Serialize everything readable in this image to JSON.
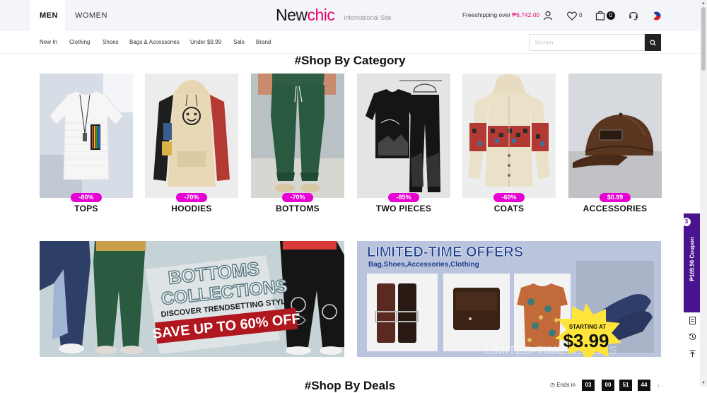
{
  "header": {
    "tabs": [
      {
        "label": "MEN",
        "active": true
      },
      {
        "label": "WOMEN",
        "active": false
      }
    ],
    "logo_main": "New",
    "logo_accent": "chic",
    "logo_sub": "International Site",
    "freeship_label": "Freeshipping over ",
    "freeship_amount": "₱6,742.00",
    "wishlist_count": "0",
    "cart_count": "0"
  },
  "nav": {
    "items": [
      "New In",
      "Clothing",
      "Shoes",
      "Bags & Accessories",
      "Under $9.99",
      "Sale",
      "Brand"
    ],
    "search_placeholder": "kitchen"
  },
  "categories_section": {
    "title": "#Shop By Category",
    "items": [
      {
        "name": "TOPS",
        "badge": "-80%"
      },
      {
        "name": "HOODIES",
        "badge": "-70%"
      },
      {
        "name": "BOTTOMS",
        "badge": "-70%"
      },
      {
        "name": "TWO PIECES",
        "badge": "-85%"
      },
      {
        "name": "COATS",
        "badge": "-60%"
      },
      {
        "name": "ACCESSORIES",
        "badge": "$0.99"
      }
    ]
  },
  "banners": {
    "bottoms": {
      "line1": "BOTTOMS",
      "line2": "COLLECTIONS",
      "tagline": "DISCOVER TRENDSETTING STYLE",
      "offer": "SAVE UP TO 60% OFF"
    },
    "limited": {
      "title": "LIMITED-TIME OFFERS",
      "subtitle": "Bag,Shoes,Accessories,Clothing",
      "starting_label": "STARTING AT",
      "price": "$3.99",
      "watermark": "LIMITED-TIME OFFERS"
    }
  },
  "deals_section": {
    "title": "#Shop By Deals",
    "ends_label": "Ends in",
    "timer": [
      "03",
      "00",
      "51",
      "44"
    ]
  },
  "side": {
    "coupon_text": "₱169.96 Coupon",
    "coupon_count": "3"
  },
  "colors": {
    "brand_accent": "#e4006b",
    "badge": "#e600d3",
    "coupon_bg": "#4a1490",
    "limited_title": "#1d3d8f"
  }
}
